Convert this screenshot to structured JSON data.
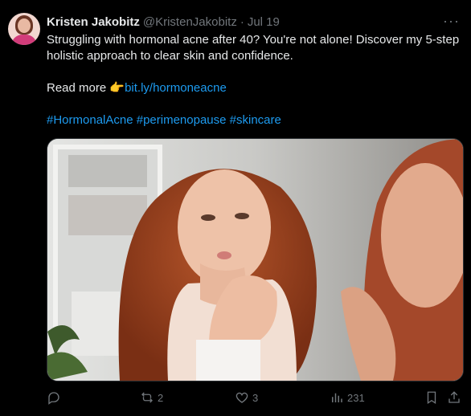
{
  "tweet": {
    "author_name": "Kristen Jakobitz",
    "handle": "@KristenJakobitz",
    "separator": "·",
    "date": "Jul 19",
    "more_label": "···",
    "text_line1": "Struggling with hormonal acne after 40? You're not alone! Discover my 5-step holistic approach to clear skin and confidence.",
    "read_more": "Read more ",
    "emoji": "👉",
    "link": "bit.ly/hormoneacne",
    "hashtags": [
      "#HormonalAcne",
      "#perimenopause",
      "#skincare"
    ]
  },
  "actions": {
    "reply_count": "",
    "retweet_count": "2",
    "like_count": "3",
    "views_count": "231"
  },
  "icons": [
    "reply-icon",
    "retweet-icon",
    "like-icon",
    "views-icon",
    "bookmark-icon",
    "share-icon"
  ],
  "colors": {
    "link": "#1d9bf0",
    "muted": "#71767b",
    "text": "#e7e9ea",
    "background": "#000000"
  }
}
